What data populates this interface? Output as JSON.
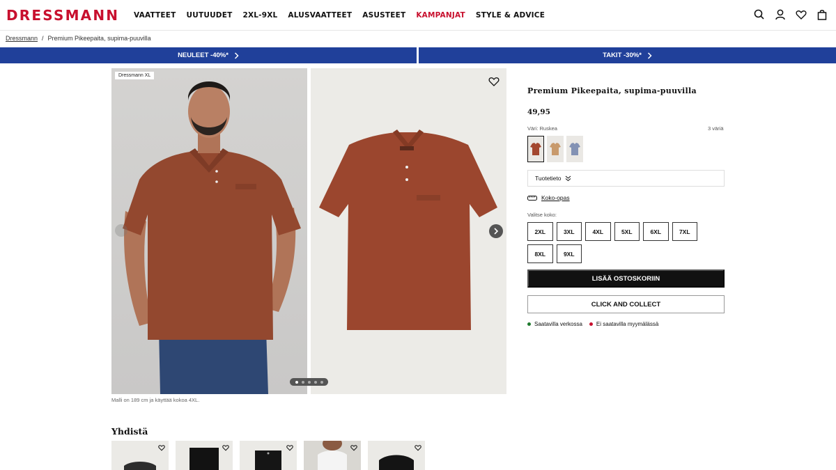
{
  "brand": {
    "logo": "DRESSMANN",
    "color": "#c8102e"
  },
  "nav": {
    "items": [
      {
        "label": "VAATTEET",
        "promo": false
      },
      {
        "label": "UUTUUDET",
        "promo": false
      },
      {
        "label": "2XL-9XL",
        "promo": false
      },
      {
        "label": "ALUSVAATTEET",
        "promo": false
      },
      {
        "label": "ASUSTEET",
        "promo": false
      },
      {
        "label": "KAMPANJAT",
        "promo": true
      },
      {
        "label": "STYLE & ADVICE",
        "promo": false
      }
    ],
    "icons": [
      "search-icon",
      "user-icon",
      "heart-icon",
      "bag-icon"
    ]
  },
  "breadcrumb": {
    "home": "Dressmann",
    "separator": "/",
    "current": "Premium Pikeepaita, supima-puuvilla"
  },
  "banners": {
    "left": "NEULEET -40%*",
    "right": "TAKIT -30%*",
    "color": "#20409a"
  },
  "gallery": {
    "badge": "Dressmann XL",
    "caption": "Malli on 189 cm ja käyttää kokoa 4XL.",
    "slides": 5,
    "active_slide": 1
  },
  "product": {
    "title": "Premium Pikeepaita, supima-puuvilla",
    "price": "49,95",
    "color_label": "Väri: Ruskea",
    "color_count": "3 väriä",
    "swatches": [
      {
        "name": "Ruskea",
        "hex": "#a3472f",
        "selected": true
      },
      {
        "name": "beige",
        "hex": "#c89a6c",
        "selected": false
      },
      {
        "name": "blue",
        "hex": "#8392b4",
        "selected": false
      }
    ],
    "accordion": "Tuotetieto",
    "size_guide": "Koko-opas",
    "size_label": "Valitse koko:",
    "sizes": [
      "2XL",
      "3XL",
      "4XL",
      "5XL",
      "6XL",
      "7XL",
      "8XL",
      "9XL"
    ],
    "add_to_cart": "LISÄÄ OSTOSKORIIN",
    "click_collect": "CLICK AND COLLECT",
    "availability": [
      {
        "text": "Saatavilla verkossa",
        "color": "#1f7a2e"
      },
      {
        "text": "Ei saatavilla myymälässä",
        "color": "#c8102e"
      }
    ]
  },
  "combine": {
    "title": "Yhdistä"
  }
}
